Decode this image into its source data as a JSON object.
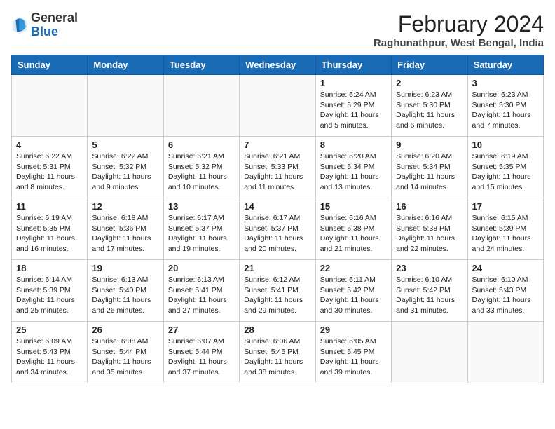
{
  "header": {
    "logo_general": "General",
    "logo_blue": "Blue",
    "title": "February 2024",
    "subtitle": "Raghunathpur, West Bengal, India"
  },
  "days_of_week": [
    "Sunday",
    "Monday",
    "Tuesday",
    "Wednesday",
    "Thursday",
    "Friday",
    "Saturday"
  ],
  "weeks": [
    [
      {
        "day": "",
        "info": ""
      },
      {
        "day": "",
        "info": ""
      },
      {
        "day": "",
        "info": ""
      },
      {
        "day": "",
        "info": ""
      },
      {
        "day": "1",
        "info": "Sunrise: 6:24 AM\nSunset: 5:29 PM\nDaylight: 11 hours and 5 minutes."
      },
      {
        "day": "2",
        "info": "Sunrise: 6:23 AM\nSunset: 5:30 PM\nDaylight: 11 hours and 6 minutes."
      },
      {
        "day": "3",
        "info": "Sunrise: 6:23 AM\nSunset: 5:30 PM\nDaylight: 11 hours and 7 minutes."
      }
    ],
    [
      {
        "day": "4",
        "info": "Sunrise: 6:22 AM\nSunset: 5:31 PM\nDaylight: 11 hours and 8 minutes."
      },
      {
        "day": "5",
        "info": "Sunrise: 6:22 AM\nSunset: 5:32 PM\nDaylight: 11 hours and 9 minutes."
      },
      {
        "day": "6",
        "info": "Sunrise: 6:21 AM\nSunset: 5:32 PM\nDaylight: 11 hours and 10 minutes."
      },
      {
        "day": "7",
        "info": "Sunrise: 6:21 AM\nSunset: 5:33 PM\nDaylight: 11 hours and 11 minutes."
      },
      {
        "day": "8",
        "info": "Sunrise: 6:20 AM\nSunset: 5:34 PM\nDaylight: 11 hours and 13 minutes."
      },
      {
        "day": "9",
        "info": "Sunrise: 6:20 AM\nSunset: 5:34 PM\nDaylight: 11 hours and 14 minutes."
      },
      {
        "day": "10",
        "info": "Sunrise: 6:19 AM\nSunset: 5:35 PM\nDaylight: 11 hours and 15 minutes."
      }
    ],
    [
      {
        "day": "11",
        "info": "Sunrise: 6:19 AM\nSunset: 5:35 PM\nDaylight: 11 hours and 16 minutes."
      },
      {
        "day": "12",
        "info": "Sunrise: 6:18 AM\nSunset: 5:36 PM\nDaylight: 11 hours and 17 minutes."
      },
      {
        "day": "13",
        "info": "Sunrise: 6:17 AM\nSunset: 5:37 PM\nDaylight: 11 hours and 19 minutes."
      },
      {
        "day": "14",
        "info": "Sunrise: 6:17 AM\nSunset: 5:37 PM\nDaylight: 11 hours and 20 minutes."
      },
      {
        "day": "15",
        "info": "Sunrise: 6:16 AM\nSunset: 5:38 PM\nDaylight: 11 hours and 21 minutes."
      },
      {
        "day": "16",
        "info": "Sunrise: 6:16 AM\nSunset: 5:38 PM\nDaylight: 11 hours and 22 minutes."
      },
      {
        "day": "17",
        "info": "Sunrise: 6:15 AM\nSunset: 5:39 PM\nDaylight: 11 hours and 24 minutes."
      }
    ],
    [
      {
        "day": "18",
        "info": "Sunrise: 6:14 AM\nSunset: 5:39 PM\nDaylight: 11 hours and 25 minutes."
      },
      {
        "day": "19",
        "info": "Sunrise: 6:13 AM\nSunset: 5:40 PM\nDaylight: 11 hours and 26 minutes."
      },
      {
        "day": "20",
        "info": "Sunrise: 6:13 AM\nSunset: 5:41 PM\nDaylight: 11 hours and 27 minutes."
      },
      {
        "day": "21",
        "info": "Sunrise: 6:12 AM\nSunset: 5:41 PM\nDaylight: 11 hours and 29 minutes."
      },
      {
        "day": "22",
        "info": "Sunrise: 6:11 AM\nSunset: 5:42 PM\nDaylight: 11 hours and 30 minutes."
      },
      {
        "day": "23",
        "info": "Sunrise: 6:10 AM\nSunset: 5:42 PM\nDaylight: 11 hours and 31 minutes."
      },
      {
        "day": "24",
        "info": "Sunrise: 6:10 AM\nSunset: 5:43 PM\nDaylight: 11 hours and 33 minutes."
      }
    ],
    [
      {
        "day": "25",
        "info": "Sunrise: 6:09 AM\nSunset: 5:43 PM\nDaylight: 11 hours and 34 minutes."
      },
      {
        "day": "26",
        "info": "Sunrise: 6:08 AM\nSunset: 5:44 PM\nDaylight: 11 hours and 35 minutes."
      },
      {
        "day": "27",
        "info": "Sunrise: 6:07 AM\nSunset: 5:44 PM\nDaylight: 11 hours and 37 minutes."
      },
      {
        "day": "28",
        "info": "Sunrise: 6:06 AM\nSunset: 5:45 PM\nDaylight: 11 hours and 38 minutes."
      },
      {
        "day": "29",
        "info": "Sunrise: 6:05 AM\nSunset: 5:45 PM\nDaylight: 11 hours and 39 minutes."
      },
      {
        "day": "",
        "info": ""
      },
      {
        "day": "",
        "info": ""
      }
    ]
  ]
}
